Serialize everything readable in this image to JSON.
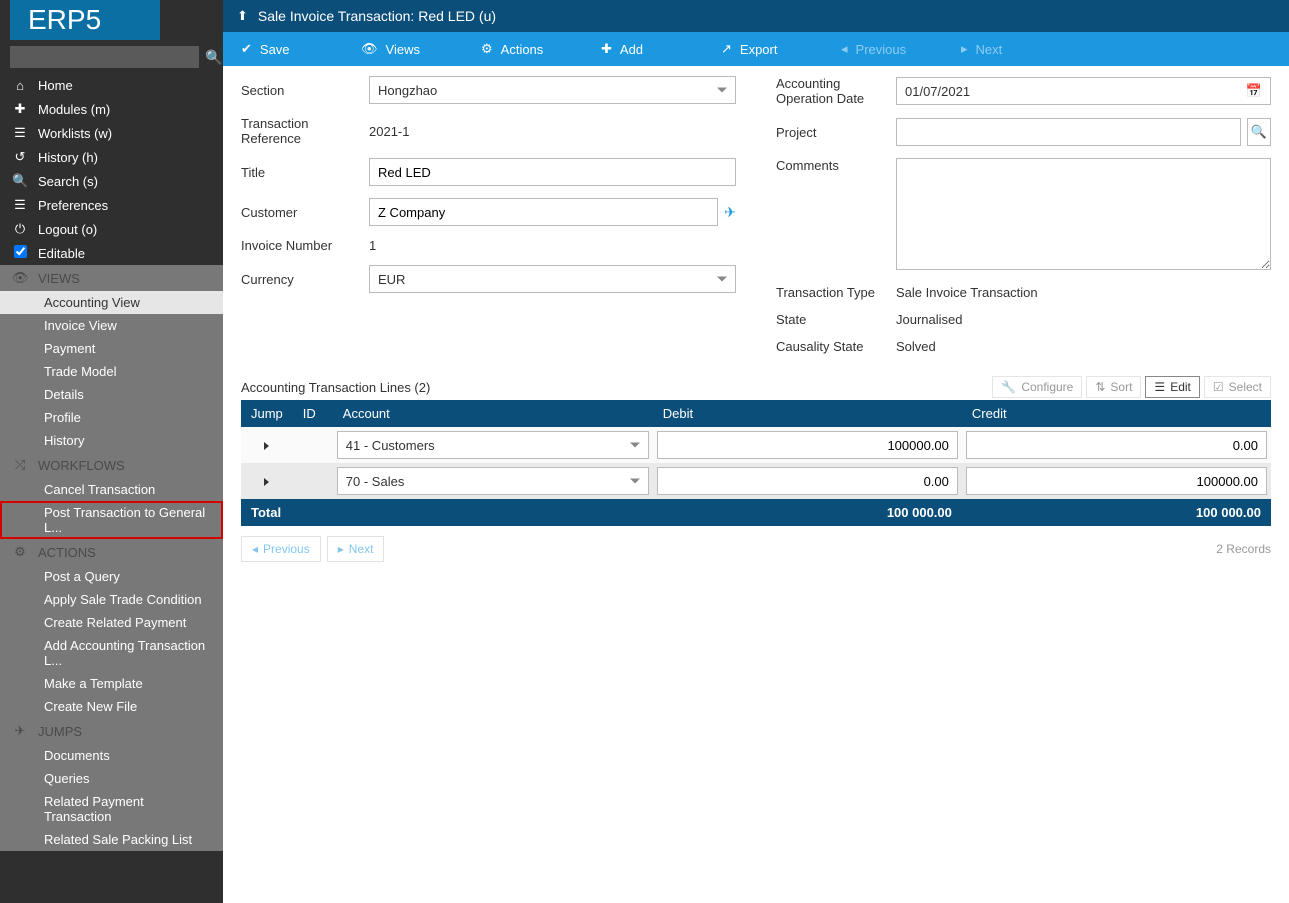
{
  "logo_text": "ERP5",
  "sidebar": {
    "search_placeholder": "",
    "nav": [
      {
        "icon": "home",
        "label": "Home"
      },
      {
        "icon": "puzzle",
        "label": "Modules (m)"
      },
      {
        "icon": "list",
        "label": "Worklists (w)"
      },
      {
        "icon": "history",
        "label": "History (h)"
      },
      {
        "icon": "search",
        "label": "Search (s)"
      },
      {
        "icon": "prefs",
        "label": "Preferences"
      },
      {
        "icon": "power",
        "label": "Logout (o)"
      },
      {
        "icon": "check",
        "label": "Editable"
      }
    ],
    "views_header": "VIEWS",
    "views": [
      "Accounting View",
      "Invoice View",
      "Payment",
      "Trade Model",
      "Details",
      "Profile",
      "History"
    ],
    "workflows_header": "WORKFLOWS",
    "workflows": [
      "Cancel Transaction",
      "Post Transaction to General L..."
    ],
    "actions_header": "ACTIONS",
    "actions": [
      "Post a Query",
      "Apply Sale Trade Condition",
      "Create Related Payment",
      "Add Accounting Transaction L...",
      "Make a Template",
      "Create New File"
    ],
    "jumps_header": "JUMPS",
    "jumps": [
      "Documents",
      "Queries",
      "Related Payment Transaction",
      "Related Sale Packing List"
    ]
  },
  "title": "Sale Invoice Transaction: Red LED (u)",
  "toolbar": {
    "save": "Save",
    "views": "Views",
    "actions": "Actions",
    "add": "Add",
    "export": "Export",
    "previous": "Previous",
    "next": "Next"
  },
  "form": {
    "section_label": "Section",
    "section_value": "Hongzhao",
    "txref_label": "Transaction Reference",
    "txref_value": "2021-1",
    "title_label": "Title",
    "title_value": "Red LED",
    "customer_label": "Customer",
    "customer_value": "Z Company",
    "invnum_label": "Invoice Number",
    "invnum_value": "1",
    "currency_label": "Currency",
    "currency_value": "EUR",
    "opdate_label": "Accounting Operation Date",
    "opdate_value": "01/07/2021",
    "project_label": "Project",
    "project_value": "",
    "comments_label": "Comments",
    "comments_value": "",
    "txtype_label": "Transaction Type",
    "txtype_value": "Sale Invoice Transaction",
    "state_label": "State",
    "state_value": "Journalised",
    "causality_label": "Causality State",
    "causality_value": "Solved"
  },
  "table": {
    "title": "Accounting Transaction Lines (2)",
    "tools": {
      "configure": "Configure",
      "sort": "Sort",
      "edit": "Edit",
      "select": "Select"
    },
    "headers": {
      "jump": "Jump",
      "id": "ID",
      "account": "Account",
      "debit": "Debit",
      "credit": "Credit"
    },
    "rows": [
      {
        "account": "41 - Customers",
        "debit": "100000.00",
        "credit": "0.00"
      },
      {
        "account": "70 - Sales",
        "debit": "0.00",
        "credit": "100000.00"
      }
    ],
    "total_label": "Total",
    "total_debit": "100 000.00",
    "total_credit": "100 000.00",
    "pager_prev": "Previous",
    "pager_next": "Next",
    "records": "2 Records"
  }
}
